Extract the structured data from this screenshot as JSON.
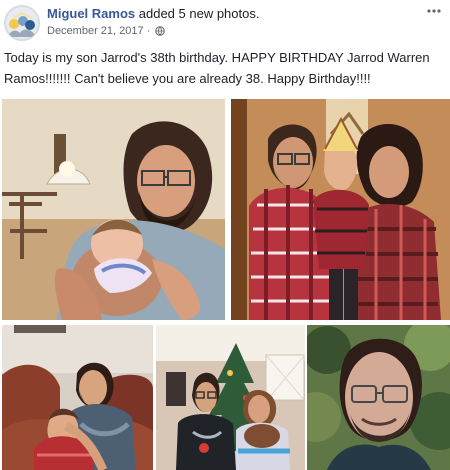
{
  "post": {
    "author": "Miguel Ramos",
    "action": "added 5 new photos.",
    "date": "December 21, 2017",
    "separator": "·",
    "privacy_icon": "globe-icon",
    "options_icon": "more-horizontal-icon",
    "caption": "Today is my son Jarrod's 38th birthday. HAPPY BIRTHDAY Jarrod Warren Ramos!!!!!!! Can't believe you are already 38. Happy Birthday!!!!",
    "photos": [
      {
        "subject": "father-holding-baby"
      },
      {
        "subject": "family-portrait-with-toddler"
      },
      {
        "subject": "father-and-son-on-couch"
      },
      {
        "subject": "family-by-christmas-tree"
      },
      {
        "subject": "young-man-portrait"
      }
    ]
  },
  "colors": {
    "name_link": "#385898",
    "text": "#1c1e21",
    "meta": "#616770"
  }
}
